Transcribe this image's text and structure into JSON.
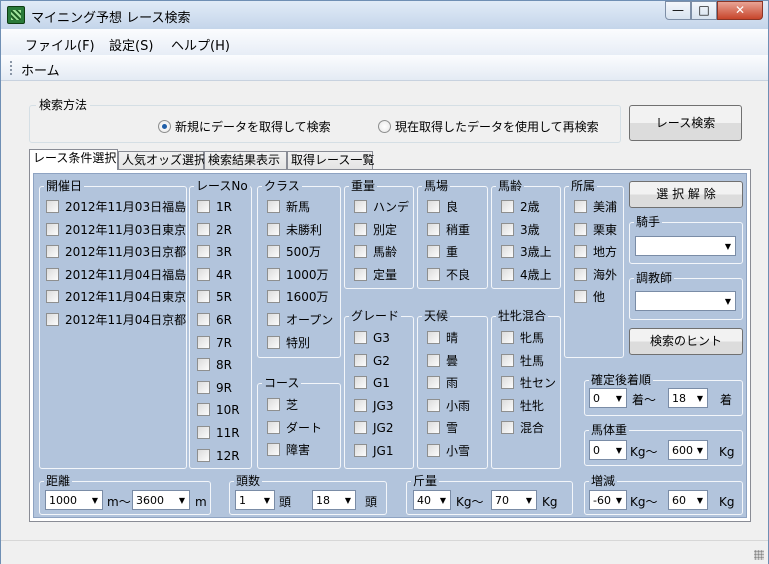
{
  "window": {
    "title": "マイニング予想  レース検索",
    "min": "—",
    "max": "□",
    "close": "✕"
  },
  "menu": [
    "ファイル(F)",
    "設定(S)",
    "ヘルプ(H)"
  ],
  "toolbar": {
    "home": "ホーム"
  },
  "search_method": {
    "legend": "検索方法",
    "option_new": "新規にデータを取得して検索",
    "option_reuse": "現在取得したデータを使用して再検索",
    "selected": "option_new"
  },
  "search_button": "レース検索",
  "tabs": [
    "レース条件選択",
    "人気オッズ選択",
    "検索結果表示",
    "取得レース一覧"
  ],
  "active_tab": 0,
  "kaisai": {
    "legend": "開催日",
    "items": [
      "2012年11月03日福島",
      "2012年11月03日東京",
      "2012年11月03日京都",
      "2012年11月04日福島",
      "2012年11月04日東京",
      "2012年11月04日京都"
    ]
  },
  "race_no": {
    "legend": "レースNo",
    "items": [
      "1R",
      "2R",
      "3R",
      "4R",
      "5R",
      "6R",
      "7R",
      "8R",
      "9R",
      "10R",
      "11R",
      "12R"
    ]
  },
  "class": {
    "legend": "クラス",
    "items": [
      "新馬",
      "未勝利",
      "500万",
      "1000万",
      "1600万",
      "オープン",
      "特別"
    ]
  },
  "course": {
    "legend": "コース",
    "items": [
      "芝",
      "ダート",
      "障害"
    ]
  },
  "weight_type": {
    "legend": "重量",
    "items": [
      "ハンデ",
      "別定",
      "馬齢",
      "定量"
    ]
  },
  "track": {
    "legend": "馬場",
    "items": [
      "良",
      "稍重",
      "重",
      "不良"
    ]
  },
  "age": {
    "legend": "馬齢",
    "items": [
      "2歳",
      "3歳",
      "3歳上",
      "4歳上"
    ]
  },
  "affiliation": {
    "legend": "所属",
    "items": [
      "美浦",
      "栗東",
      "地方",
      "海外",
      "他"
    ]
  },
  "grade": {
    "legend": "グレード",
    "items": [
      "G3",
      "G2",
      "G1",
      "JG3",
      "JG2",
      "JG1"
    ]
  },
  "weather": {
    "legend": "天候",
    "items": [
      "晴",
      "曇",
      "雨",
      "小雨",
      "雪",
      "小雪"
    ]
  },
  "sex": {
    "legend": "牡牝混合",
    "items": [
      "牝馬",
      "牡馬",
      "牡セン",
      "牡牝",
      "混合"
    ]
  },
  "clear_button": "選 択 解 除",
  "jockey": {
    "legend": "騎手",
    "value": ""
  },
  "trainer": {
    "legend": "調教師",
    "value": ""
  },
  "hint_button": "検索のヒント",
  "finish": {
    "legend": "確定後着順",
    "from": "0",
    "sep": "着〜",
    "to": "18",
    "unit": "着"
  },
  "body_weight": {
    "legend": "馬体重",
    "from": "0",
    "sep": "Kg〜",
    "to": "600",
    "unit": "Kg"
  },
  "distance": {
    "legend": "距離",
    "from": "1000",
    "sep": "m〜",
    "to": "3600",
    "unit": "m"
  },
  "heads": {
    "legend": "頭数",
    "from": "1",
    "sep": "頭",
    "to": "18",
    "unit": "頭"
  },
  "kinryo": {
    "legend": "斤量",
    "from": "40",
    "sep": "Kg〜",
    "to": "70",
    "unit": "Kg"
  },
  "change": {
    "legend": "増減",
    "from": "-60",
    "sep": "Kg〜",
    "to": "60",
    "unit": "Kg"
  },
  "icons": {
    "dropdown": "▼"
  }
}
